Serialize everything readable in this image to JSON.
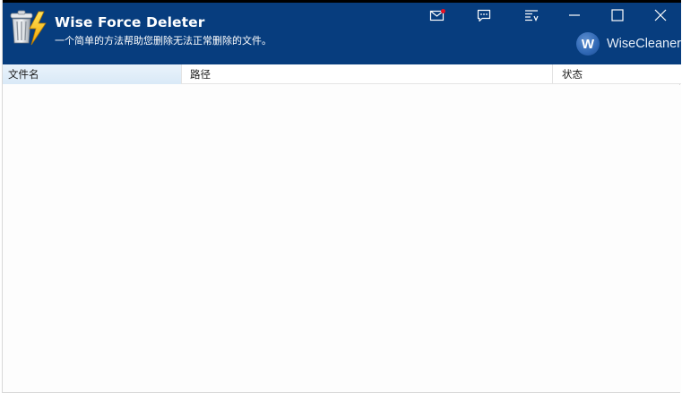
{
  "app": {
    "title": "Wise Force Deleter",
    "subtitle": "一个简单的方法帮助您删除无法正常删除的文件。",
    "brand_badge": "W",
    "brand_name": "WiseCleaner"
  },
  "titlebar_icons": {
    "mail": "mail-icon",
    "feedback": "feedback-icon",
    "menu": "menu-icon",
    "minimize": "minimize-icon",
    "maximize": "maximize-icon",
    "close": "close-icon",
    "notification_dot_color": "#e81123"
  },
  "colors": {
    "titlebar": "#073d7e",
    "header_selected": "#d9e9f7"
  },
  "file_list": {
    "columns": [
      "文件名",
      "路径",
      "状态"
    ],
    "rows": []
  }
}
